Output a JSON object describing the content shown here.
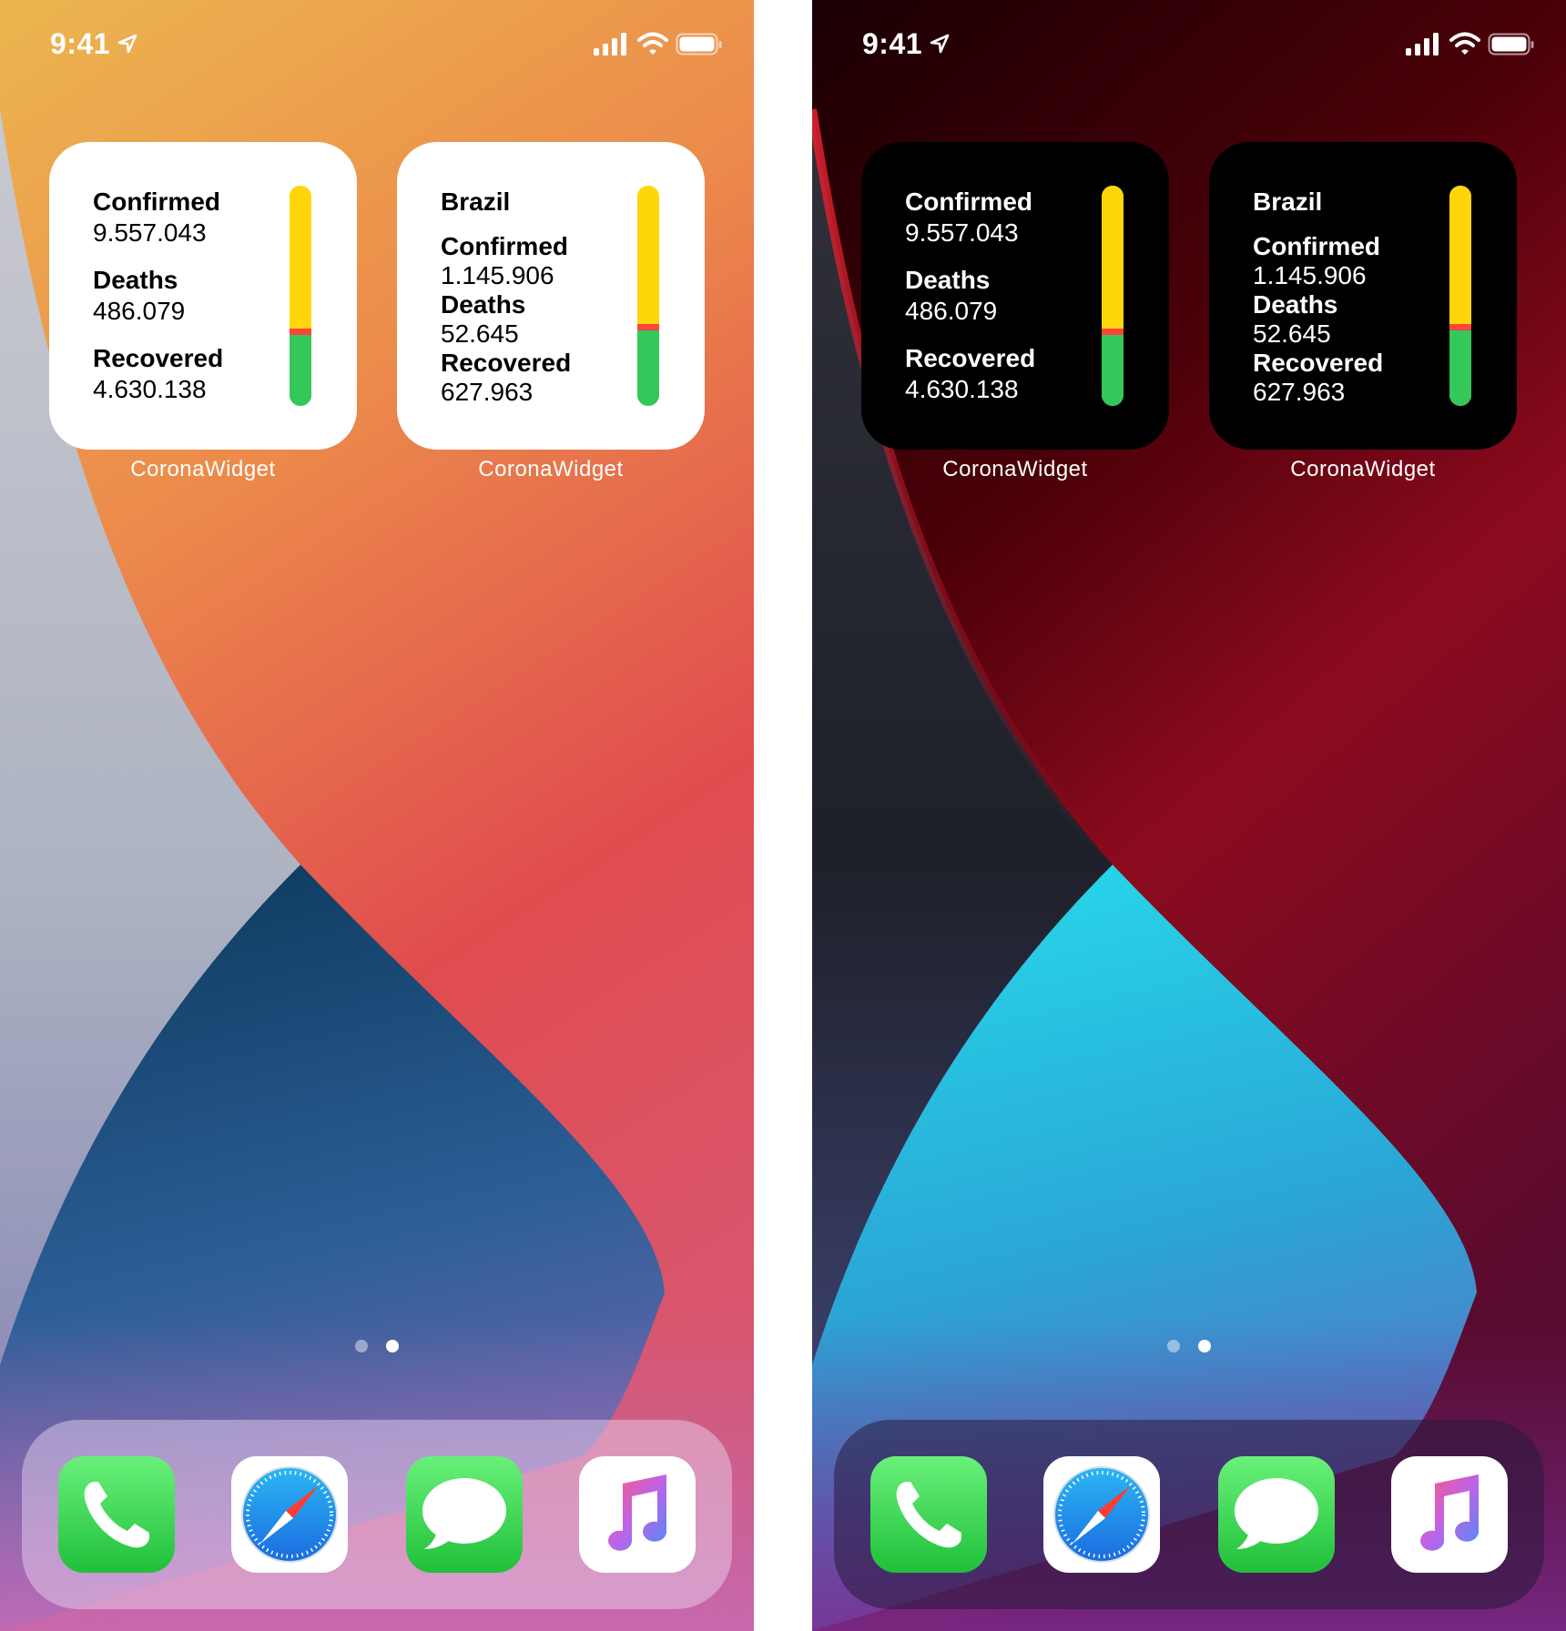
{
  "status": {
    "time": "9:41"
  },
  "widgets": {
    "global": {
      "rows": [
        {
          "label": "Confirmed",
          "value": "9.557.043"
        },
        {
          "label": "Deaths",
          "value": "486.079"
        },
        {
          "label": "Recovered",
          "value": "4.630.138"
        }
      ],
      "bar": {
        "confirmed_fraction": 0.65,
        "deaths_fraction": 0.03,
        "recovered_fraction": 0.32
      },
      "caption": "CoronaWidget"
    },
    "country": {
      "title": "Brazil",
      "rows": [
        {
          "label": "Confirmed",
          "value": "1.145.906"
        },
        {
          "label": "Deaths",
          "value": "52.645"
        },
        {
          "label": "Recovered",
          "value": "627.963"
        }
      ],
      "bar": {
        "confirmed_fraction": 0.63,
        "deaths_fraction": 0.03,
        "recovered_fraction": 0.34
      },
      "caption": "CoronaWidget"
    }
  },
  "colors": {
    "confirmed": "#FFD60A",
    "deaths": "#FF453A",
    "recovered": "#34C759"
  },
  "page_dots": {
    "count": 2,
    "active_index": 1
  },
  "dock": {
    "apps": [
      {
        "icon": "phone-icon"
      },
      {
        "icon": "safari-icon"
      },
      {
        "icon": "messages-icon"
      },
      {
        "icon": "music-icon"
      }
    ]
  }
}
